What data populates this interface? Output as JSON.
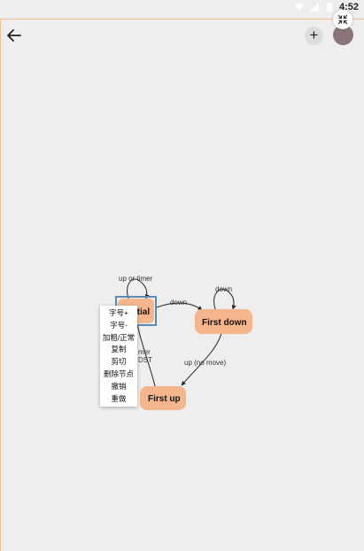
{
  "status_bar": {
    "time": "4:52",
    "icons": [
      "wifi-icon",
      "signal-icon",
      "battery-icon"
    ]
  },
  "toolbar": {
    "back_icon": "arrow-left-icon",
    "add_label": "+",
    "fullscreen_icon": "collapse-arrows-icon"
  },
  "diagram": {
    "nodes": [
      {
        "id": "initial",
        "label": "Initial",
        "selected": true,
        "color": "#f6b68d"
      },
      {
        "id": "first-down",
        "label": "First down",
        "selected": false,
        "color": "#f6b68d"
      },
      {
        "id": "first-up",
        "label": "First up",
        "selected": false,
        "color": "#f6b68d"
      }
    ],
    "edges": [
      {
        "from": "initial",
        "to": "initial",
        "label": "up or timer"
      },
      {
        "from": "initial",
        "to": "first-down",
        "label": "down"
      },
      {
        "from": "first-down",
        "to": "first-down",
        "label": "down"
      },
      {
        "from": "first-down",
        "to": "first-up",
        "label": "up (no move)"
      },
      {
        "from": "first-up",
        "to": "initial",
        "label_fragments": [
          "mer",
          "DST"
        ]
      }
    ],
    "selection_color": "#5b8bb5",
    "edge_color": "#222222"
  },
  "context_menu": {
    "items": [
      "字号+",
      "字号-",
      "加粗/正常",
      "复制",
      "剪切",
      "删除节点",
      "撤销",
      "重做"
    ]
  }
}
